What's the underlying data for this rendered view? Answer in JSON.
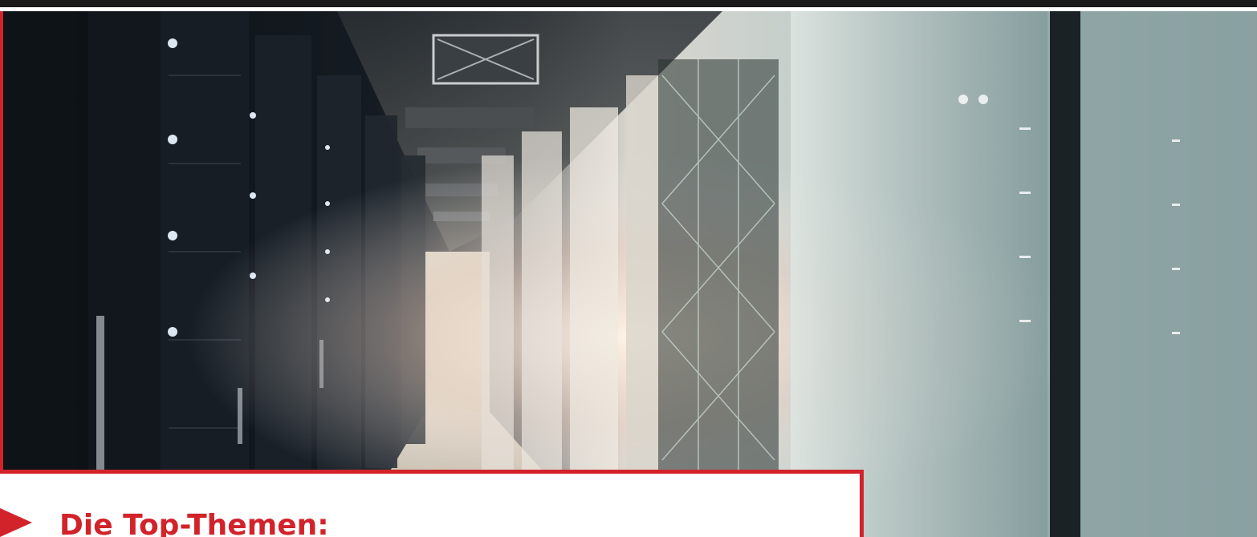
{
  "hero": {
    "image_description": "data-center-server-corridor"
  },
  "topics": {
    "heading": "Die Top-Themen:"
  },
  "colors": {
    "accent": "#d2232a",
    "dark": "#1a1a1a"
  }
}
